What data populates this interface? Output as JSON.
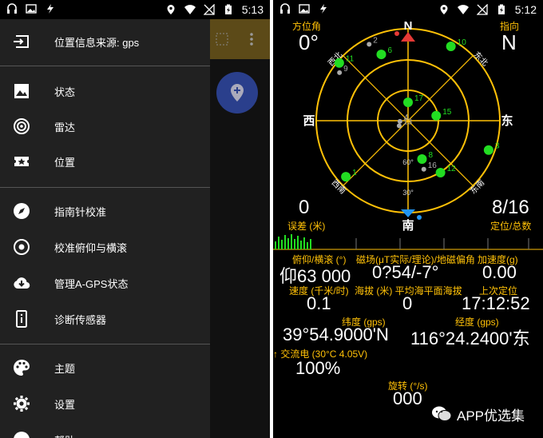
{
  "status_left": {
    "time": "5:13"
  },
  "status_right": {
    "time": "5:12"
  },
  "drawer": {
    "header": {
      "label": "位置信息来源: gps"
    },
    "items": [
      {
        "label": "状态",
        "icon": "image-icon"
      },
      {
        "label": "雷达",
        "icon": "radar-icon"
      },
      {
        "label": "位置",
        "icon": "map-ticket-icon"
      },
      {
        "label": "指南针校准",
        "icon": "compass-icon"
      },
      {
        "label": "校准俯仰与横滚",
        "icon": "target-icon"
      },
      {
        "label": "管理A-GPS状态",
        "icon": "cloud-download-icon"
      },
      {
        "label": "诊断传感器",
        "icon": "device-info-icon"
      },
      {
        "label": "主题",
        "icon": "palette-icon"
      },
      {
        "label": "设置",
        "icon": "gear-icon"
      },
      {
        "label": "帮助",
        "icon": "help-icon"
      }
    ]
  },
  "radar": {
    "azimuth_label": "方位角",
    "azimuth_value": "0°",
    "direction_label": "指向",
    "direction_value": "N",
    "error_value": "0",
    "error_label": "误差 (米)",
    "fix_value": "8/16",
    "fix_label": "定位/总数",
    "compass": {
      "n": "N",
      "e": "东",
      "s": "南",
      "w": "西",
      "nw": "西北",
      "ne": "东北",
      "sw": "西南",
      "se": "东南"
    },
    "ring_labels": {
      "r60": "60°",
      "r30": "30°"
    },
    "satellites": [
      {
        "id": "2",
        "used": false,
        "az": 333,
        "el": 6
      },
      {
        "id": "6",
        "used": true,
        "az": 338,
        "el": 20
      },
      {
        "id": "11",
        "used": true,
        "az": 310,
        "el": 2
      },
      {
        "id": "9",
        "used": false,
        "az": 305,
        "el": 8
      },
      {
        "id": "10",
        "used": true,
        "az": 30,
        "el": 6
      },
      {
        "id": "17",
        "used": true,
        "az": 0,
        "el": 72
      },
      {
        "id": "4",
        "used": false,
        "az": 265,
        "el": 82
      },
      {
        "id": "13",
        "used": false,
        "az": 240,
        "el": 80
      },
      {
        "id": "15",
        "used": true,
        "az": 80,
        "el": 62
      },
      {
        "id": "8",
        "used": true,
        "az": 160,
        "el": 50
      },
      {
        "id": "16",
        "used": false,
        "az": 162,
        "el": 40
      },
      {
        "id": "12",
        "used": true,
        "az": 148,
        "el": 30
      },
      {
        "id": "3",
        "used": true,
        "az": 110,
        "el": 6
      },
      {
        "id": "1",
        "used": true,
        "az": 228,
        "el": 8
      }
    ]
  },
  "readings": {
    "pitch_roll_label": "俯仰/横滚 (°)",
    "magnetic_label": "磁场(μT实际/理论)/地磁偏角",
    "accel_label": "加速度(g)",
    "pitch_roll_value": "仰63 000",
    "magnetic_value": "0?54/-7°",
    "accel_value": "0.00",
    "speed_label": "速度 (千米/时)",
    "altitude_label": "海拔 (米) 平均海平面海拔",
    "last_fix_label": "上次定位",
    "speed_value": "0.1",
    "altitude_value": "0",
    "last_fix_value": "17:12:52",
    "lat_label": "纬度 (gps)",
    "lon_label": "经度 (gps)",
    "lat_value": "39°54.9000'N",
    "lon_value": "116°24.2400'东",
    "battery_label": "↑ 交流电 (30°C 4.05V)",
    "battery_value": "100%",
    "rotation_label": "旋转 (°/s)",
    "rotation_value": "000"
  },
  "watermark": {
    "text": "APP优选集"
  },
  "colors": {
    "accent": "#ffc107",
    "used_sat": "#22dd22",
    "unused_sat": "#aaaaaa",
    "north": "#e53935",
    "south": "#2196f3"
  }
}
